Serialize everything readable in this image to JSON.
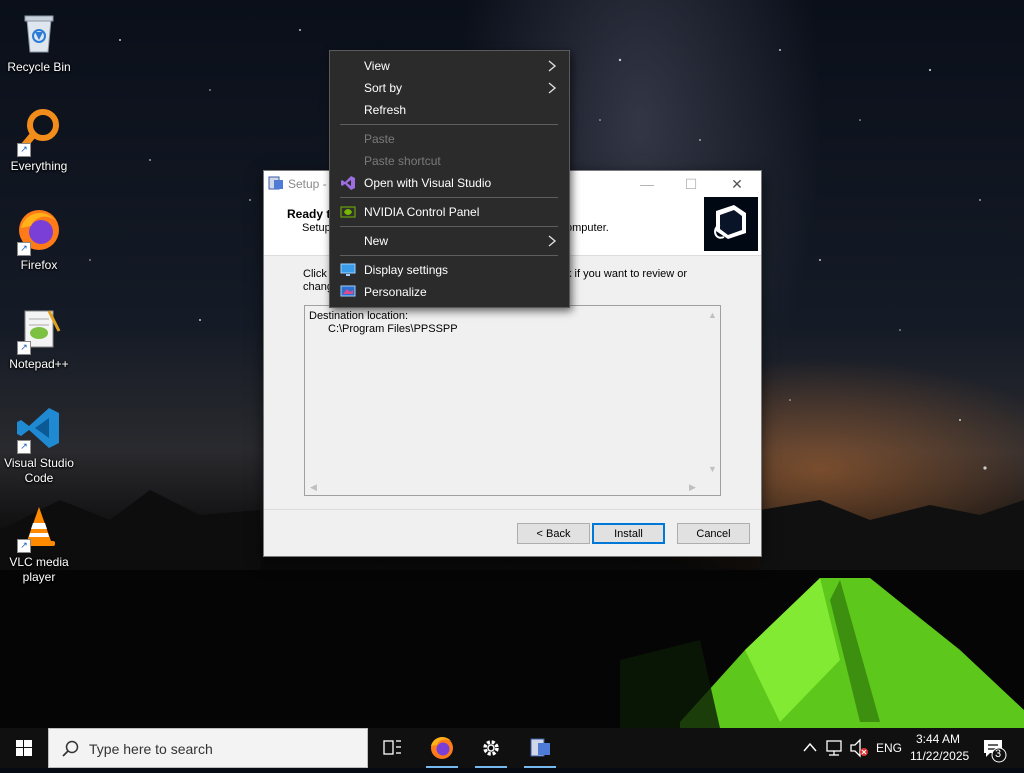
{
  "desktop": {
    "icons": [
      {
        "label": "Recycle Bin"
      },
      {
        "label": "Everything"
      },
      {
        "label": "Firefox"
      },
      {
        "label": "Notepad++"
      },
      {
        "label": "Visual Studio Code"
      },
      {
        "label": "VLC media player"
      }
    ]
  },
  "setup_window": {
    "title": "Setup -",
    "header_title": "Ready t",
    "header_sub": "Setup",
    "header_sub_end": "omputer.",
    "body_line1_start": "Click I",
    "body_line1_end": "k if you want to review or",
    "body_line2_start": "chang",
    "memo_line1": "Destination location:",
    "memo_line2": "C:\\Program Files\\PPSSPP",
    "back_label": "< Back",
    "install_label": "Install",
    "cancel_label": "Cancel"
  },
  "context_menu": {
    "items": [
      {
        "label": "View",
        "has_submenu": true,
        "enabled": true
      },
      {
        "label": "Sort by",
        "has_submenu": true,
        "enabled": true
      },
      {
        "label": "Refresh",
        "enabled": true
      },
      {
        "label": "Paste",
        "enabled": false
      },
      {
        "label": "Paste shortcut",
        "enabled": false
      },
      {
        "label": "Open with Visual Studio",
        "icon": "visual-studio-icon",
        "enabled": true
      },
      {
        "label": "NVIDIA Control Panel",
        "icon": "nvidia-icon",
        "enabled": true
      },
      {
        "label": "New",
        "has_submenu": true,
        "enabled": true
      },
      {
        "label": "Display settings",
        "icon": "display-icon",
        "enabled": true
      },
      {
        "label": "Personalize",
        "icon": "personalize-icon",
        "enabled": true
      }
    ]
  },
  "taskbar": {
    "search_placeholder": "Type here to search",
    "language": "ENG",
    "time": "3:44 AM",
    "date": "11/22/2025",
    "notification_count": "3"
  },
  "colors": {
    "accent": "#0078d7",
    "menu_bg": "#2b2b2b",
    "taskbar_bg": "#101010"
  }
}
